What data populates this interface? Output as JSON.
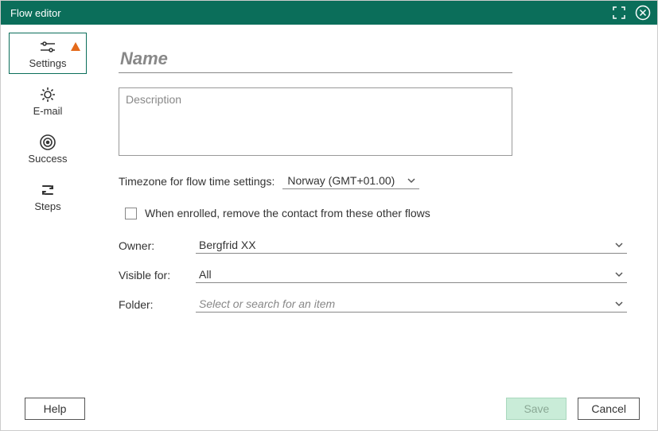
{
  "titlebar": {
    "title": "Flow editor"
  },
  "sidebar": {
    "items": [
      {
        "label": "Settings"
      },
      {
        "label": "E-mail"
      },
      {
        "label": "Success"
      },
      {
        "label": "Steps"
      }
    ]
  },
  "main": {
    "name_placeholder": "Name",
    "description_placeholder": "Description",
    "timezone_label": "Timezone for flow time settings:",
    "timezone_value": "Norway (GMT+01.00)",
    "checkbox_label": "When enrolled, remove the contact from these other flows",
    "owner_label": "Owner:",
    "owner_value": "Bergfrid XX",
    "visible_label": "Visible for:",
    "visible_value": "All",
    "folder_label": "Folder:",
    "folder_placeholder": "Select or search for an item"
  },
  "footer": {
    "help": "Help",
    "save": "Save",
    "cancel": "Cancel"
  }
}
